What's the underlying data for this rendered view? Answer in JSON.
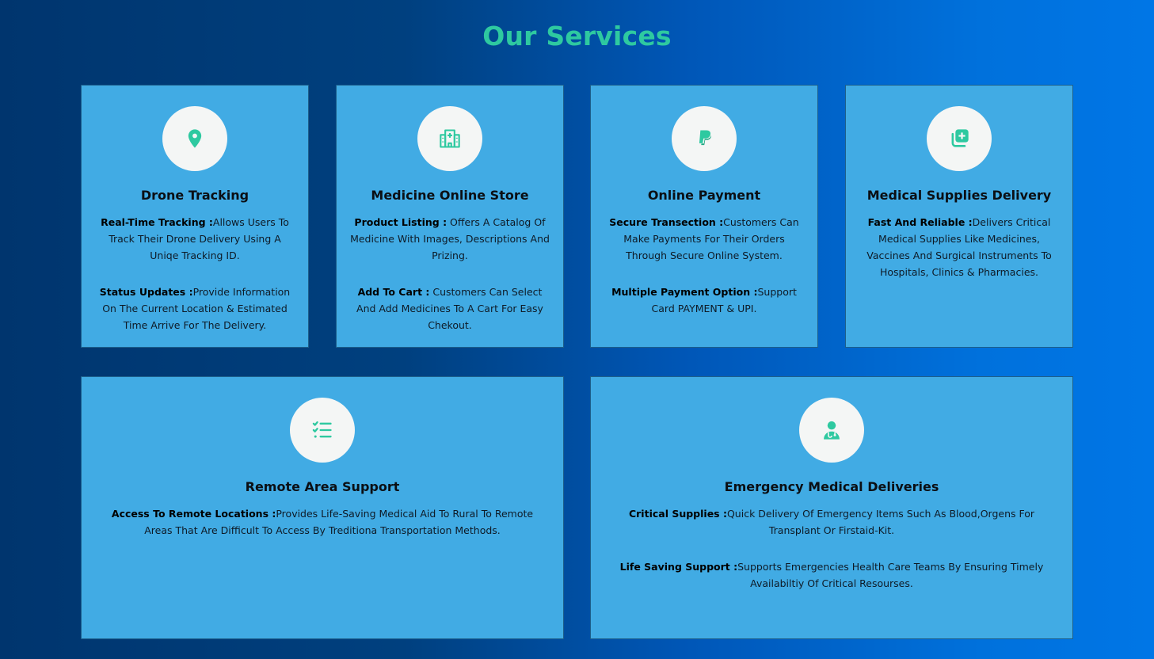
{
  "page": {
    "title": "Our Services",
    "accent_color": "#2ec9a0",
    "card_color": "#41abe4"
  },
  "cards": [
    {
      "title": "Drone Tracking",
      "icon": "location-pin-icon",
      "paragraphs": [
        {
          "label": "Real-Time Tracking :",
          "text": "Allows Users To Track Their Drone Delivery Using A Uniqe Tracking ID."
        },
        {
          "label": "Status Updates :",
          "text": "Provide Information On The Current Location & Estimated Time Arrive For The Delivery."
        }
      ]
    },
    {
      "title": "Medicine Online Store",
      "icon": "hospital-icon",
      "paragraphs": [
        {
          "label": "Product Listing :",
          "text": " Offers A Catalog Of Medicine With Images, Descriptions And Prizing."
        },
        {
          "label": "Add To Cart :",
          "text": " Customers Can Select And Add Medicines To A Cart For Easy Chekout."
        }
      ]
    },
    {
      "title": "Online Payment",
      "icon": "paypal-icon",
      "paragraphs": [
        {
          "label": "Secure Transection :",
          "text": "Customers Can Make Payments For Their Orders Through Secure Online System."
        },
        {
          "label": "Multiple Payment Option :",
          "text": "Support Card PAYMENT & UPI."
        }
      ]
    },
    {
      "title": "Medical Supplies Delivery",
      "icon": "medical-supplies-icon",
      "paragraphs": [
        {
          "label": "Fast And Reliable :",
          "text": "Delivers Critical Medical Supplies Like Medicines, Vaccines And Surgical Instruments To Hospitals, Clinics & Pharmacies."
        }
      ]
    },
    {
      "title": "Remote Area Support",
      "icon": "checklist-icon",
      "paragraphs": [
        {
          "label": "Access To Remote Locations :",
          "text": "Provides Life-Saving Medical Aid To Rural To Remote Areas That Are Difficult To Access By Treditiona Transportation Methods."
        }
      ]
    },
    {
      "title": "Emergency Medical Deliveries",
      "icon": "doctor-icon",
      "paragraphs": [
        {
          "label": "Critical Supplies :",
          "text": "Quick Delivery Of Emergency Items Such As Blood,Orgens For Transplant Or Firstaid-Kit."
        },
        {
          "label": "Life Saving Support :",
          "text": "Supports Emergencies Health Care Teams By Ensuring Timely Availabiltiy Of Critical Resourses."
        }
      ]
    }
  ]
}
